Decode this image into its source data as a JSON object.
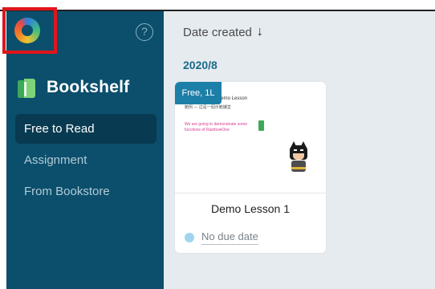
{
  "sidebar": {
    "brand_title": "Bookshelf",
    "help_glyph": "?",
    "nav": [
      {
        "label": "Free to Read",
        "active": true
      },
      {
        "label": "Assignment",
        "active": false
      },
      {
        "label": "From Bookstore",
        "active": false
      }
    ]
  },
  "main": {
    "sort_label": "Date created",
    "sort_arrow": "🡓",
    "group_date": "2020/8",
    "cards": [
      {
        "badge": "Free, 1L",
        "thumb_line1": "is a Demo Lesson",
        "thumb_line2": "範例 — 這是一個示範課堂",
        "thumb_pink": "We are going to demonstrate some functions of RainbowOne",
        "title": "Demo Lesson 1",
        "due": "No due date"
      }
    ]
  },
  "colors": {
    "sidebar_bg": "#0b4f6c",
    "active_nav_bg": "#083a51",
    "main_bg": "#e6ebef",
    "badge_bg": "#1c7fa8",
    "accent_date": "#1a6a8a",
    "highlight_box": "#e0161b"
  },
  "icons": {
    "app_logo": "rainbow-ring-logo",
    "help": "help-circle-icon",
    "brand": "book-icon",
    "sort": "arrow-down-icon",
    "due_status": "status-dot-icon"
  }
}
